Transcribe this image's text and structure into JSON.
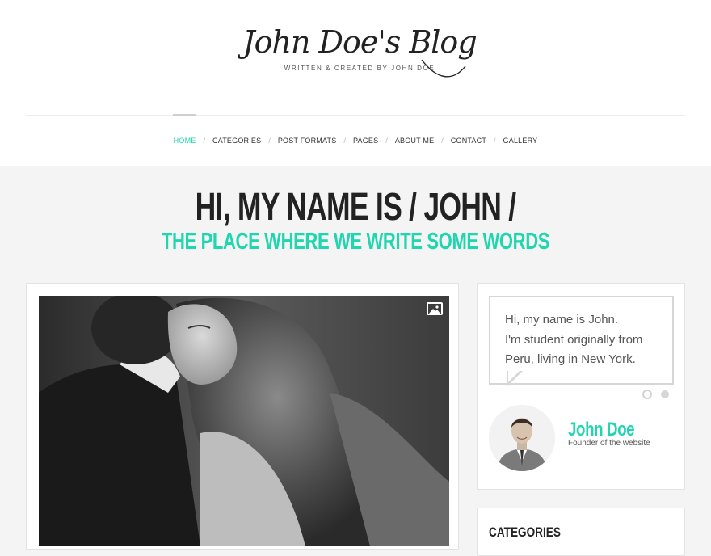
{
  "site": {
    "title": "John Doe's Blog",
    "tagline": "WRITTEN & CREATED BY JOHN DOE"
  },
  "nav": {
    "items": [
      "HOME",
      "CATEGORIES",
      "POST FORMATS",
      "PAGES",
      "ABOUT ME",
      "CONTACT",
      "GALLERY"
    ],
    "active": "HOME",
    "separator": "/"
  },
  "hero": {
    "title": "HI, MY NAME IS / JOHN /",
    "subtitle": "THE PLACE WHERE WE WRITE SOME WORDS"
  },
  "post": {
    "format_icon": "image-icon"
  },
  "about": {
    "bio_lines": [
      "Hi, my name is John.",
      "I'm student originally from",
      "Peru, living in New York."
    ],
    "name": "John Doe",
    "role": "Founder of the website",
    "slider_dots": 2,
    "active_dot": 1
  },
  "categories_widget": {
    "title": "CATEGORIES"
  },
  "colors": {
    "accent": "#1fd6ae",
    "text": "#222222",
    "background": "#f4f4f4"
  }
}
